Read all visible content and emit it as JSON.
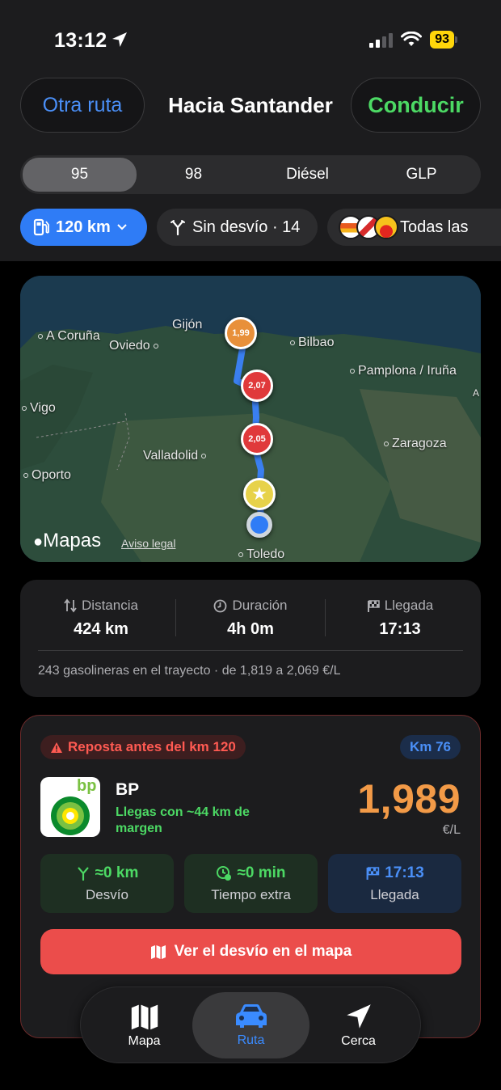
{
  "status_bar": {
    "time": "13:12",
    "battery": "93"
  },
  "header": {
    "left_button": "Otra ruta",
    "title": "Hacia Santander",
    "right_button": "Conducir"
  },
  "fuel_types": {
    "options": [
      "95",
      "98",
      "Diésel",
      "GLP"
    ],
    "selected": "95"
  },
  "filters": {
    "range": "120 km",
    "detour": "Sin desvío · 14",
    "brands": "Todas las"
  },
  "map": {
    "cities": [
      "A Coruña",
      "Gijón",
      "Oviedo",
      "Bilbao",
      "Pamplona / Iruña",
      "Vigo",
      "Zaragoza",
      "Valladolid",
      "Oporto",
      "Toledo",
      "A"
    ],
    "pins": [
      "1,99",
      "2,07",
      "2,05"
    ],
    "attribution": "Mapas",
    "legal": "Aviso legal"
  },
  "stats": {
    "distance_label": "Distancia",
    "distance": "424 km",
    "duration_label": "Duración",
    "duration": "4h 0m",
    "arrival_label": "Llegada",
    "arrival": "17:13",
    "summary": "243 gasolineras en el trayecto · de 1,819 a 2,069 €/L"
  },
  "station": {
    "warning": "Reposta antes del km 120",
    "km": "Km 76",
    "brand": "BP",
    "margin": "Llegas con ~44 km de margen",
    "price": "1,989",
    "unit": "€/L",
    "detour_value": "≈0 km",
    "detour_label": "Desvío",
    "extra_value": "≈0 min",
    "extra_label": "Tiempo extra",
    "arrival_value": "17:13",
    "arrival_label": "Llegada",
    "map_button": "Ver el desvío en el mapa",
    "logo_text": "bp"
  },
  "tabs": [
    {
      "label": "Mapa"
    },
    {
      "label": "Ruta"
    },
    {
      "label": "Cerca"
    }
  ],
  "colors": {
    "accent_blue": "#2f7cf6",
    "green": "#4cd964",
    "orange_price": "#f29a47",
    "warning_red": "#eb4d4b"
  }
}
